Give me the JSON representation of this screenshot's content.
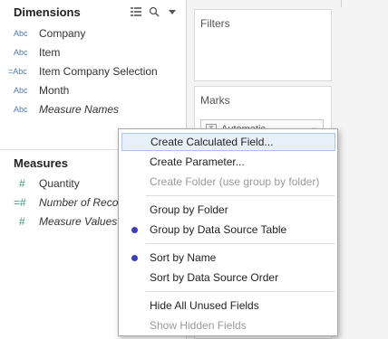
{
  "data_pane": {
    "dimensions_title": "Dimensions",
    "measures_title": "Measures",
    "header_icons": [
      "list-view-icon",
      "search-icon",
      "caret-down-icon"
    ],
    "dimensions": [
      {
        "type": "Abc",
        "name": "Company",
        "italic": false
      },
      {
        "type": "Abc",
        "name": "Item",
        "italic": false
      },
      {
        "type": "=Abc",
        "name": "Item Company Selection",
        "italic": false
      },
      {
        "type": "Abc",
        "name": "Month",
        "italic": false
      },
      {
        "type": "Abc",
        "name": "Measure Names",
        "italic": true
      }
    ],
    "measures": [
      {
        "type": "#",
        "name": "Quantity",
        "italic": false
      },
      {
        "type": "=#",
        "name": "Number of Reco",
        "italic": true
      },
      {
        "type": "#",
        "name": "Measure Values",
        "italic": true
      }
    ]
  },
  "shelves": {
    "filters_title": "Filters",
    "marks_title": "Marks",
    "marks_type": "Automatic"
  },
  "context_menu": {
    "items": [
      {
        "label": "Create Calculated Field...",
        "disabled": false,
        "highlighted": true,
        "checked": false
      },
      {
        "label": "Create Parameter...",
        "disabled": false,
        "highlighted": false,
        "checked": false
      },
      {
        "label": "Create Folder (use group by folder)",
        "disabled": true,
        "highlighted": false,
        "checked": false
      },
      {
        "label": "Group by Folder",
        "disabled": false,
        "highlighted": false,
        "checked": false
      },
      {
        "label": "Group by Data Source Table",
        "disabled": false,
        "highlighted": false,
        "checked": true
      },
      {
        "label": "Sort by Name",
        "disabled": false,
        "highlighted": false,
        "checked": true
      },
      {
        "label": "Sort by Data Source Order",
        "disabled": false,
        "highlighted": false,
        "checked": false
      },
      {
        "label": "Hide All Unused Fields",
        "disabled": false,
        "highlighted": false,
        "checked": false
      },
      {
        "label": "Show Hidden Fields",
        "disabled": true,
        "highlighted": false,
        "checked": false
      }
    ]
  },
  "colors": {
    "dimension_type": "#4e79a7",
    "measure_type": "#3a9a7a",
    "radio_dot": "#3b3fb5",
    "highlight": "#e8f0fb"
  }
}
